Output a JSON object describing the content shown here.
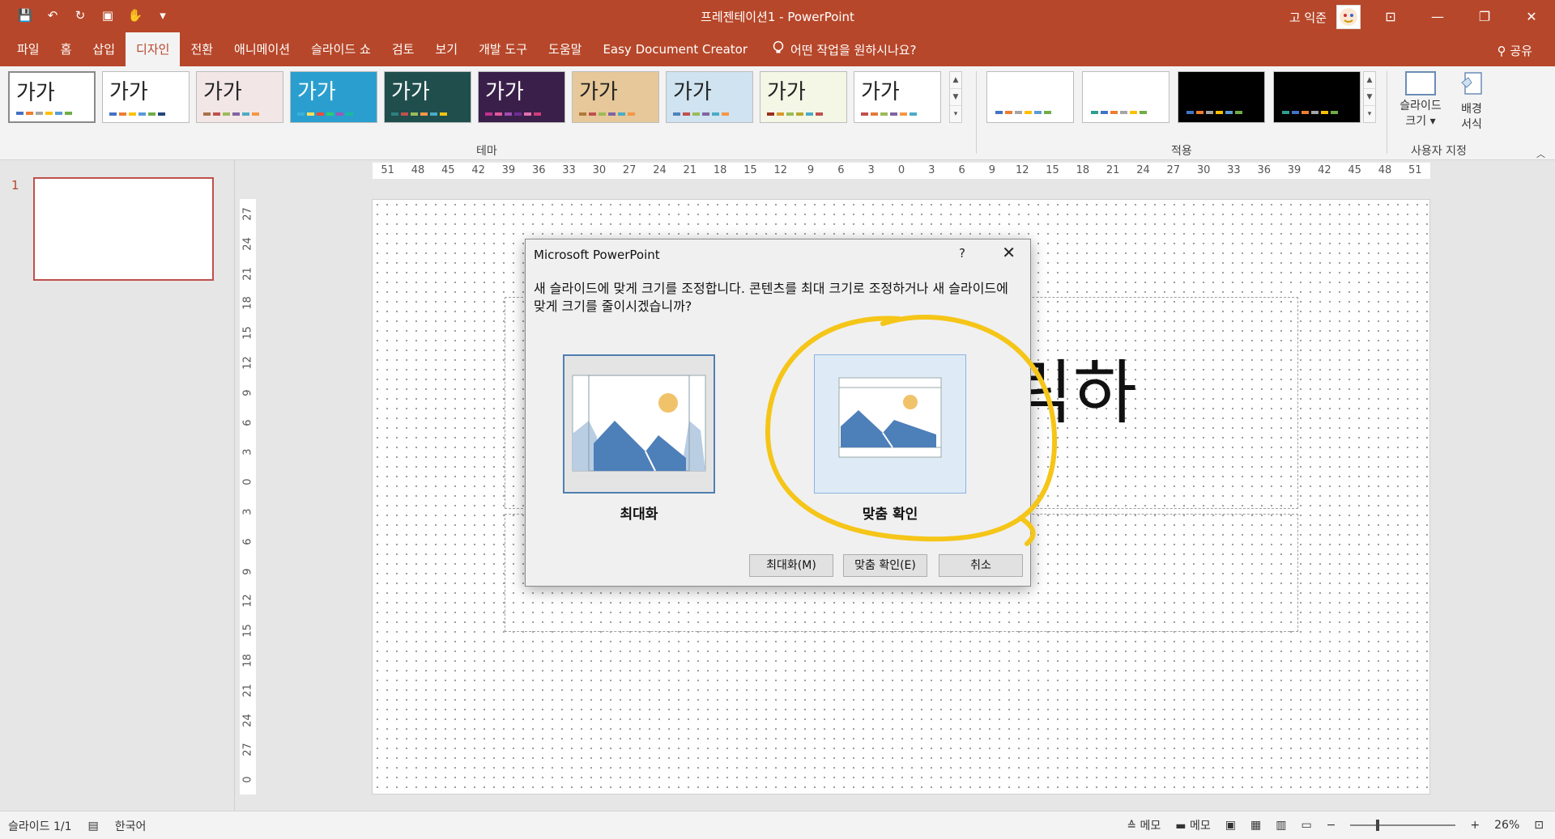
{
  "window": {
    "title": "프레젠테이션1  -  PowerPoint",
    "user_name": "고 익준",
    "controls": [
      "⊡",
      "❐",
      "✕"
    ]
  },
  "qat": [
    "💾",
    "↶",
    "↻",
    "▣",
    "✋",
    "▾"
  ],
  "tabs": [
    {
      "label": "파일"
    },
    {
      "label": "홈"
    },
    {
      "label": "삽입"
    },
    {
      "label": "디자인",
      "active": true
    },
    {
      "label": "전환"
    },
    {
      "label": "애니메이션"
    },
    {
      "label": "슬라이드 쇼"
    },
    {
      "label": "검토"
    },
    {
      "label": "보기"
    },
    {
      "label": "개발 도구"
    },
    {
      "label": "도움말"
    },
    {
      "label": "Easy Document Creator"
    }
  ],
  "tell_me": "어떤 작업을 원하시나요?",
  "share": "공유",
  "ribbon": {
    "theme_sample_text": "가가",
    "themes_group_label": "테마",
    "variants_group_label": "적용",
    "customize_group_label": "사용자 지정",
    "slide_size_label": "슬라이드\n크기 ▾",
    "background_format_label": "배경\n서식",
    "themes": [
      {
        "bg": "#ffffff",
        "dots": [
          "#4472c4",
          "#ed7d31",
          "#a5a5a5",
          "#ffc000",
          "#5b9bd5",
          "#70ad47"
        ]
      },
      {
        "bg": "#ffffff",
        "dots": [
          "#4472c4",
          "#ed7d31",
          "#ffc000",
          "#5b9bd5",
          "#70ad47",
          "#264478"
        ]
      },
      {
        "bg": "#f2e7e6",
        "dots": [
          "#a9714a",
          "#c0504d",
          "#9bbb59",
          "#8064a2",
          "#4bacc6",
          "#f79646"
        ]
      },
      {
        "bg": "#2a9fcf",
        "dots": [
          "#3ab0da",
          "#ffe05c",
          "#e74c3c",
          "#2ecc71",
          "#9b59b6",
          "#1abc9c"
        ]
      },
      {
        "bg": "#1f4e4d",
        "dots": [
          "#2d8080",
          "#c0504d",
          "#9bbb59",
          "#f79646",
          "#4bacc6",
          "#f2c314"
        ]
      },
      {
        "bg": "#3a1f4a",
        "dots": [
          "#c0338f",
          "#e0589b",
          "#a04db0",
          "#6f2d91",
          "#e36fb0",
          "#d13c7b"
        ]
      },
      {
        "bg": "#e6c89a",
        "dots": [
          "#b07a3a",
          "#c0504d",
          "#9bbb59",
          "#8064a2",
          "#4bacc6",
          "#f79646"
        ]
      },
      {
        "bg": "#cfe3f0",
        "dots": [
          "#4f81bd",
          "#c0504d",
          "#9bbb59",
          "#8064a2",
          "#4bacc6",
          "#f79646"
        ]
      },
      {
        "bg": "#f4f6e6",
        "dots": [
          "#9b2d1e",
          "#d99a2e",
          "#9bbb59",
          "#b8a830",
          "#4bacc6",
          "#c0504d"
        ]
      },
      {
        "bg": "#ffffff",
        "dots": [
          "#c0504d",
          "#e47a3b",
          "#9bbb59",
          "#8064a2",
          "#f79646",
          "#4bacc6"
        ]
      }
    ],
    "variants": [
      {
        "bg": "#ffffff",
        "dots": [
          "#4472c4",
          "#ed7d31",
          "#a5a5a5",
          "#ffc000",
          "#5b9bd5",
          "#70ad47"
        ]
      },
      {
        "bg": "#ffffff",
        "dots": [
          "#2e9e8f",
          "#4472c4",
          "#ed7d31",
          "#a5a5a5",
          "#ffc000",
          "#70ad47"
        ]
      },
      {
        "bg": "#000000",
        "dots": [
          "#4472c4",
          "#ed7d31",
          "#a5a5a5",
          "#ffc000",
          "#5b9bd5",
          "#70ad47"
        ]
      },
      {
        "bg": "#000000",
        "dots": [
          "#2e9e8f",
          "#4472c4",
          "#ed7d31",
          "#a5a5a5",
          "#ffc000",
          "#70ad47"
        ]
      }
    ]
  },
  "slide_panel": {
    "number": "1"
  },
  "ruler": {
    "horizontal": [
      "51",
      "48",
      "45",
      "42",
      "39",
      "36",
      "33",
      "30",
      "27",
      "24",
      "21",
      "18",
      "15",
      "12",
      "9",
      "6",
      "3",
      "0",
      "3",
      "6",
      "9",
      "12",
      "15",
      "18",
      "21",
      "24",
      "27",
      "30",
      "33",
      "36",
      "39",
      "42",
      "45",
      "48",
      "51"
    ],
    "vertical": [
      "27",
      "24",
      "21",
      "18",
      "15",
      "12",
      "9",
      "6",
      "3",
      "0",
      "3",
      "6",
      "9",
      "12",
      "15",
      "18",
      "21",
      "24",
      "27",
      "0"
    ]
  },
  "slide": {
    "title_fragment": "면 클릭하"
  },
  "dialog": {
    "title": "Microsoft PowerPoint",
    "help": "?",
    "close": "✕",
    "message": "새 슬라이드에 맞게 크기를 조정합니다. 콘텐츠를 최대 크기로 조정하거나 새 슬라이드에 맞게 크기를 줄이시겠습니까?",
    "option_maximize": "최대화",
    "option_fit": "맞춤 확인",
    "btn_maximize": "최대화(M)",
    "btn_fit": "맞춤 확인(E)",
    "btn_cancel": "취소",
    "highlight_color": "#f5c518"
  },
  "status": {
    "slide_count": "슬라이드 1/1",
    "language": "한국어",
    "notes": "메모",
    "comments": "메모",
    "zoom": "26%",
    "zoom_level": 0.26
  }
}
